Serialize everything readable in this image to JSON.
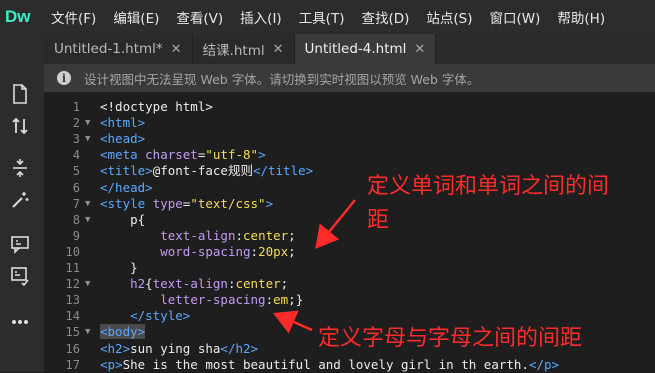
{
  "app": {
    "logo": "Dw"
  },
  "menu": [
    "文件(F)",
    "编辑(E)",
    "查看(V)",
    "插入(I)",
    "工具(T)",
    "查找(D)",
    "站点(S)",
    "窗口(W)",
    "帮助(H)"
  ],
  "tabs": [
    {
      "label": "Untitled-1.html*",
      "close": "✕",
      "active": false
    },
    {
      "label": "结课.html",
      "close": "✕",
      "active": false
    },
    {
      "label": "Untitled-4.html",
      "close": "✕",
      "active": true
    }
  ],
  "info": {
    "icon": "i",
    "text": "设计视图中无法呈现 Web 字体。请切换到实时视图以预览 Web 字体。"
  },
  "sidebar_icons": [
    "file-icon",
    "sort-arrows-icon",
    "expand-icon",
    "wand-icon",
    "comment-icon",
    "format-icon",
    "more-icon"
  ],
  "annotations": {
    "first_line1": "定义单词和单词之间的间",
    "first_line2": "距",
    "second": "定义字母与字母之间的间距",
    "color": "#ff2b2b"
  },
  "code_lines": [
    {
      "n": "1",
      "fold": "",
      "parts": [
        [
          "plain",
          "<!doctype html>"
        ]
      ]
    },
    {
      "n": "2",
      "fold": "▼",
      "parts": [
        [
          "tag",
          "<html>"
        ]
      ]
    },
    {
      "n": "3",
      "fold": "▼",
      "parts": [
        [
          "tag",
          "<head>"
        ]
      ]
    },
    {
      "n": "4",
      "fold": "",
      "parts": [
        [
          "tag",
          "<meta "
        ],
        [
          "attr",
          "charset"
        ],
        [
          "plain",
          "="
        ],
        [
          "str",
          "\"utf-8\""
        ],
        [
          "tag",
          ">"
        ]
      ]
    },
    {
      "n": "5",
      "fold": "",
      "parts": [
        [
          "tag",
          "<title>"
        ],
        [
          "plain",
          "@font-face规则"
        ],
        [
          "tag",
          "</title>"
        ]
      ]
    },
    {
      "n": "6",
      "fold": "",
      "parts": [
        [
          "tag",
          "</head>"
        ]
      ]
    },
    {
      "n": "7",
      "fold": "▼",
      "parts": [
        [
          "tag",
          "<style "
        ],
        [
          "attr",
          "type"
        ],
        [
          "plain",
          "="
        ],
        [
          "str",
          "\"text/css\""
        ],
        [
          "tag",
          ">"
        ]
      ]
    },
    {
      "n": "8",
      "fold": "▼",
      "parts": [
        [
          "plain",
          "    p{"
        ]
      ]
    },
    {
      "n": "9",
      "fold": "",
      "parts": [
        [
          "plain",
          "        "
        ],
        [
          "prop",
          "text-align"
        ],
        [
          "plain",
          ":"
        ],
        [
          "val",
          "center"
        ],
        [
          "plain",
          ";"
        ]
      ]
    },
    {
      "n": "10",
      "fold": "",
      "parts": [
        [
          "plain",
          "        "
        ],
        [
          "prop",
          "word-spacing"
        ],
        [
          "plain",
          ":"
        ],
        [
          "val",
          "20px"
        ],
        [
          "plain",
          ";"
        ]
      ]
    },
    {
      "n": "11",
      "fold": "",
      "parts": [
        [
          "plain",
          "    }"
        ]
      ]
    },
    {
      "n": "12",
      "fold": "▼",
      "parts": [
        [
          "plain",
          "    "
        ],
        [
          "prop",
          "h2"
        ],
        [
          "plain",
          "{"
        ],
        [
          "prop",
          "text-align"
        ],
        [
          "plain",
          ":"
        ],
        [
          "val",
          "center"
        ],
        [
          "plain",
          ";"
        ]
      ]
    },
    {
      "n": "13",
      "fold": "",
      "parts": [
        [
          "plain",
          "        "
        ],
        [
          "prop",
          "letter-spacing"
        ],
        [
          "plain",
          ":"
        ],
        [
          "val",
          "em"
        ],
        [
          "plain",
          ";}"
        ]
      ]
    },
    {
      "n": "14",
      "fold": "",
      "parts": [
        [
          "plain",
          "    "
        ],
        [
          "tag",
          "</style>"
        ]
      ]
    },
    {
      "n": "15",
      "fold": "▼",
      "parts": [
        [
          "tag hl",
          "<body>"
        ]
      ]
    },
    {
      "n": "16",
      "fold": "",
      "parts": [
        [
          "tag",
          "<h2>"
        ],
        [
          "plain",
          "sun ying sha"
        ],
        [
          "tag",
          "</h2>"
        ]
      ]
    },
    {
      "n": "17",
      "fold": "",
      "parts": [
        [
          "tag",
          "<p>"
        ],
        [
          "plain",
          "She is the most beautiful and lovely girl in th earth."
        ],
        [
          "tag",
          "</p>"
        ]
      ]
    }
  ]
}
